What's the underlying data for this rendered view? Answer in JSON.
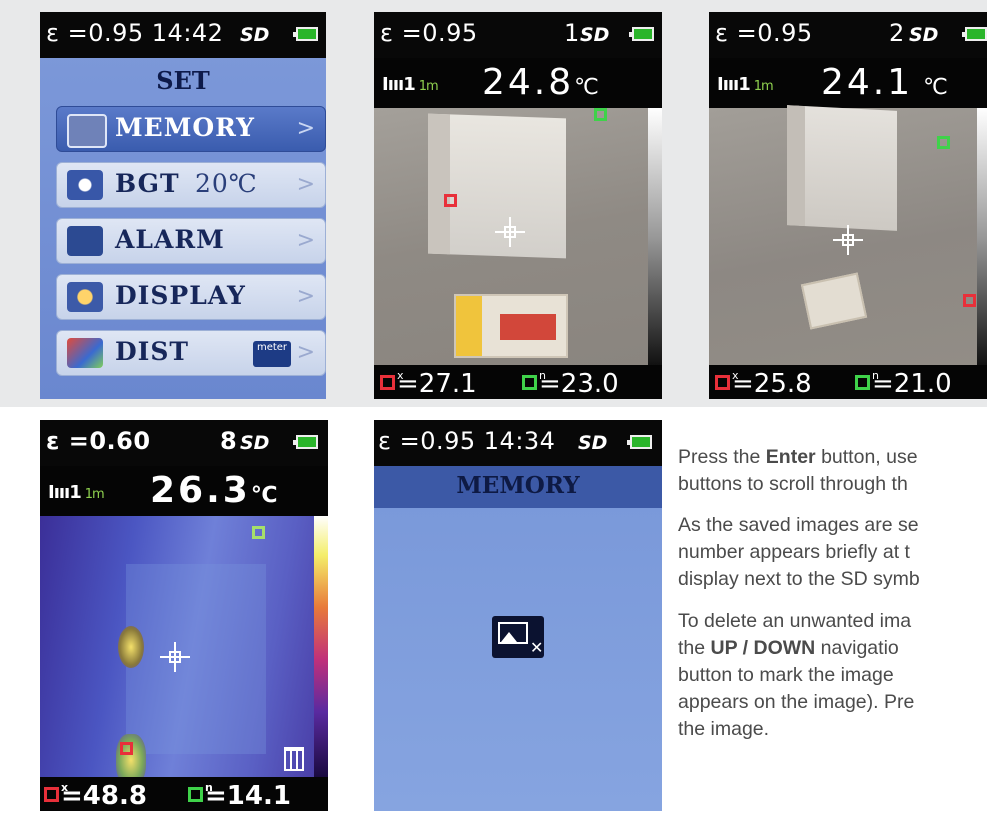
{
  "set_screen": {
    "status": "ε =0.95 14:42",
    "sd": "SD",
    "title": "SET",
    "items": [
      {
        "label": "MEMORY",
        "extra": ""
      },
      {
        "label": "BGT",
        "extra": "20℃"
      },
      {
        "label": "ALARM",
        "extra": ""
      },
      {
        "label": "DISPLAY",
        "extra": ""
      },
      {
        "label": "DIST",
        "extra": ""
      }
    ],
    "chevron": ">",
    "meter_label": "meter"
  },
  "image1": {
    "emissivity": "ε =0.95",
    "number": "1",
    "sd": "SD",
    "distance": "1m",
    "temp": "24.8",
    "unit": "℃",
    "max": "=27.1",
    "min": "=23.0",
    "max_sub": "x",
    "min_sub": "n"
  },
  "image2": {
    "emissivity": "ε =0.95",
    "number": "2",
    "sd": "SD",
    "distance": "1m",
    "temp": "24.1",
    "unit": "℃",
    "max": "=25.8",
    "min": "=21.0",
    "max_sub": "x",
    "min_sub": "n"
  },
  "image8": {
    "emissivity": "ε =0.60",
    "number": "8",
    "sd": "SD",
    "distance": "1m",
    "temp": "26.3",
    "unit": "℃",
    "max": "=48.8",
    "min": "=14.1",
    "max_sub": "x",
    "min_sub": "n"
  },
  "memory_screen": {
    "status": "ε =0.95 14:34",
    "sd": "SD",
    "title": "MEMORY"
  },
  "instructions": {
    "p1_a": "Press the ",
    "p1_b": "Enter",
    "p1_c": " button, use",
    "p1_line2": "buttons to scroll through th",
    "p2_line1": "As the saved images are se",
    "p2_line2": "number appears briefly at t",
    "p2_line3": "display next to the SD symb",
    "p3_line1": "To delete an unwanted ima",
    "p3_line2_a": "the ",
    "p3_line2_b": "UP / DOWN",
    "p3_line2_c": " navigatio",
    "p3_line3": "button to mark the image",
    "p3_line4": "appears on the image). Pre",
    "p3_line5": "the image."
  },
  "colors": {
    "menu_bg": "#6f8ed6",
    "memory_bg": "#7b9bd9",
    "max_marker": "#e8303a",
    "min_marker": "#3fd24a",
    "battery": "#2ab52a"
  }
}
